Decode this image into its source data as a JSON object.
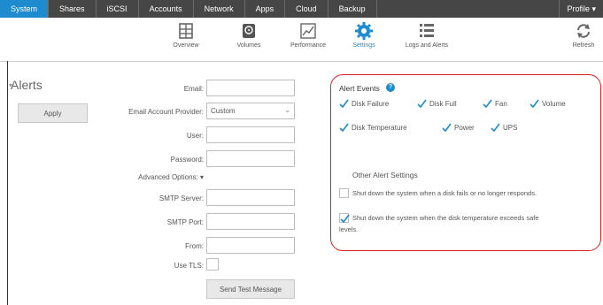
{
  "topnav": {
    "tabs": [
      {
        "label": "System"
      },
      {
        "label": "Shares"
      },
      {
        "label": "iSCSI"
      },
      {
        "label": "Accounts"
      },
      {
        "label": "Network"
      },
      {
        "label": "Apps"
      },
      {
        "label": "Cloud"
      },
      {
        "label": "Backup"
      }
    ],
    "profile": "Profile ▾"
  },
  "subnav": {
    "items": [
      {
        "label": "Overview",
        "icon": "overview-icon"
      },
      {
        "label": "Volumes",
        "icon": "volumes-icon"
      },
      {
        "label": "Performance",
        "icon": "performance-icon"
      },
      {
        "label": "Settings",
        "icon": "settings-icon"
      },
      {
        "label": "Logs and Alerts",
        "icon": "logs-icon"
      }
    ],
    "refresh": "Refresh"
  },
  "page": {
    "title": "Alerts",
    "apply": "Apply"
  },
  "form": {
    "email_label": "Email:",
    "email_value": "",
    "provider_label": "Email Account Provider:",
    "provider_value": "Custom",
    "user_label": "User:",
    "password_label": "Password:",
    "advanced_label": "Advanced Options: ▾",
    "smtp_server_label": "SMTP Server:",
    "smtp_port_label": "SMTP Port:",
    "from_label": "From:",
    "tls_label": "Use TLS:",
    "send_test": "Send Test Message"
  },
  "alert_events": {
    "title": "Alert Events",
    "items": [
      {
        "label": "Disk Failure",
        "checked": true
      },
      {
        "label": "Disk Full",
        "checked": true
      },
      {
        "label": "Fan",
        "checked": true
      },
      {
        "label": "Volume",
        "checked": true
      },
      {
        "label": "Disk Temperature",
        "checked": true
      },
      {
        "label": "Power",
        "checked": true
      },
      {
        "label": "UPS",
        "checked": true
      }
    ]
  },
  "other_settings": {
    "title": "Other Alert Settings",
    "shutdown_disk": "Shut down the system when a disk fails or no longer responds.",
    "shutdown_disk_checked": false,
    "shutdown_temp_line1": "Shut down the system when the disk temperature exceeds safe",
    "shutdown_temp_line2": "levels.",
    "shutdown_temp_checked": true
  },
  "colors": {
    "accent": "#1f8bcf",
    "highlight": "#e02020",
    "topbar": "#464646"
  }
}
